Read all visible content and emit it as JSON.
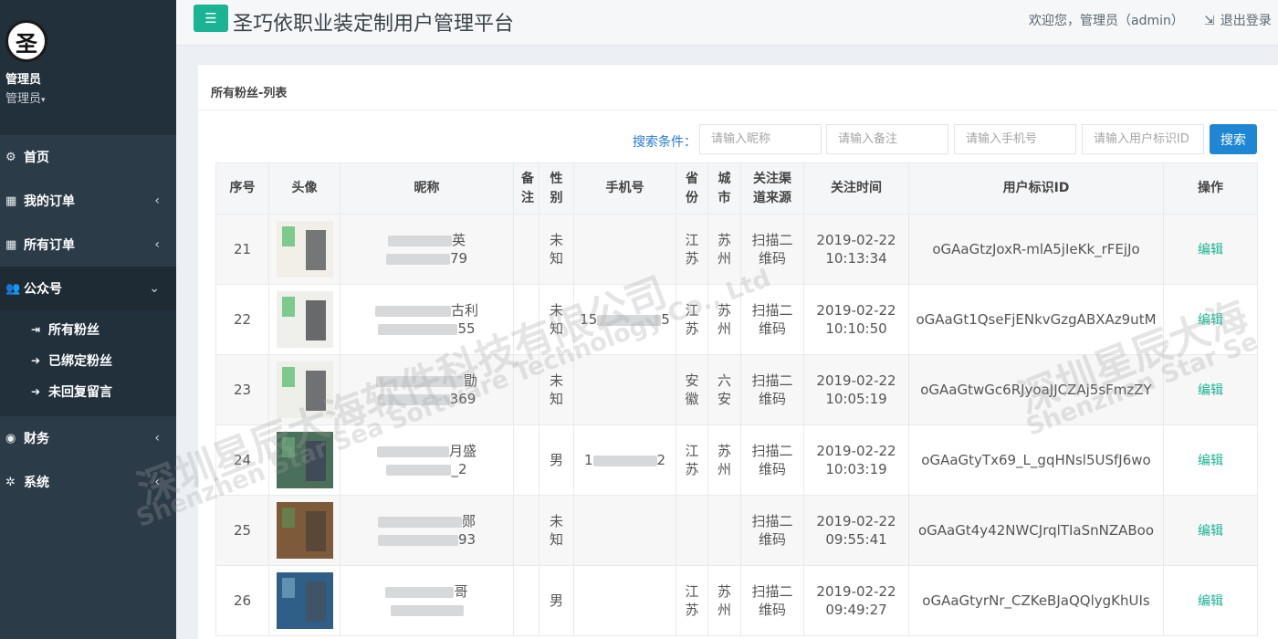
{
  "sidebar": {
    "avatar_text": "圣",
    "user_name": "管理员",
    "user_role": "管理员",
    "nav": {
      "home": "首页",
      "my_orders": "我的订单",
      "all_orders": "所有订单",
      "official_account": "公众号",
      "all_fans": "所有粉丝",
      "bound_fans": "已绑定粉丝",
      "unreplied": "未回复留言",
      "finance": "财务",
      "system": "系统"
    },
    "colors": {
      "background": "#2c3b48",
      "accent": "#1ab394"
    }
  },
  "header": {
    "title": "圣巧依职业装定制用户管理平台",
    "welcome": "欢迎您，管理员（admin）",
    "logout": "退出登录"
  },
  "panel": {
    "title": "所有粉丝-列表"
  },
  "search": {
    "label": "搜索条件：",
    "nickname_placeholder": "请输入昵称",
    "remark_placeholder": "请输入备注",
    "phone_placeholder": "请输入手机号",
    "userid_placeholder": "请输入用户标识ID",
    "button": "搜索"
  },
  "table": {
    "columns": {
      "seq": "序号",
      "avatar": "头像",
      "nickname": "昵称",
      "remark": "备注",
      "gender": "性别",
      "phone": "手机号",
      "province": "省份",
      "city": "城市",
      "channel": "关注渠道来源",
      "time": "关注时间",
      "userid": "用户标识ID",
      "action": "操作"
    },
    "rows": [
      {
        "seq": "21",
        "nick_top": "英",
        "nick_bottom": "79",
        "gender": "未知",
        "phone_head": "",
        "phone_tail": "",
        "province": "江苏",
        "city": "苏州",
        "channel": "扫描二维码",
        "date": "2019-02-22",
        "time": "10:13:34",
        "userid": "oGAaGtzJoxR-mlA5jIeKk_rFEjJo",
        "action": "编辑"
      },
      {
        "seq": "22",
        "nick_top": "古利",
        "nick_bottom": "55",
        "gender": "未知",
        "phone_head": "15",
        "phone_tail": "5",
        "province": "江苏",
        "city": "苏州",
        "channel": "扫描二维码",
        "date": "2019-02-22",
        "time": "10:10:50",
        "userid": "oGAaGt1QseFjENkvGzgABXAz9utM",
        "action": "编辑"
      },
      {
        "seq": "23",
        "nick_top": "勖",
        "nick_bottom": "369",
        "gender": "未知",
        "phone_head": "",
        "phone_tail": "",
        "province": "安徽",
        "city": "六安",
        "channel": "扫描二维码",
        "date": "2019-02-22",
        "time": "10:05:19",
        "userid": "oGAaGtwGc6RJyoaJJCZAj5sFmzZY",
        "action": "编辑"
      },
      {
        "seq": "24",
        "nick_top": "月盛",
        "nick_bottom": "_2",
        "gender": "男",
        "phone_head": "1",
        "phone_tail": "2",
        "province": "江苏",
        "city": "苏州",
        "channel": "扫描二维码",
        "date": "2019-02-22",
        "time": "10:03:19",
        "userid": "oGAaGtyTx69_L_gqHNsl5USfJ6wo",
        "action": "编辑"
      },
      {
        "seq": "25",
        "nick_top": "郧",
        "nick_bottom": "93",
        "gender": "未知",
        "phone_head": "",
        "phone_tail": "",
        "province": "",
        "city": "",
        "channel": "扫描二维码",
        "date": "2019-02-22",
        "time": "09:55:41",
        "userid": "oGAaGt4y42NWCJrqlTIaSnNZABoo",
        "action": "编辑"
      },
      {
        "seq": "26",
        "nick_top": "哥",
        "nick_bottom": "",
        "gender": "男",
        "phone_head": "",
        "phone_tail": "",
        "province": "江苏",
        "city": "苏州",
        "channel": "扫描二维码",
        "date": "2019-02-22",
        "time": "09:49:27",
        "userid": "oGAaGtyrNr_CZKeBJaQQlygKhUIs",
        "action": "编辑"
      }
    ]
  },
  "watermark": {
    "line_cn": "深圳星辰大海软件科技有限公司",
    "line_en": "Shenzhen Star Sea Software Technology Co., Ltd",
    "line_cn_short": "深圳星辰大海",
    "line_en_short": "Shenzhen Star Se"
  }
}
